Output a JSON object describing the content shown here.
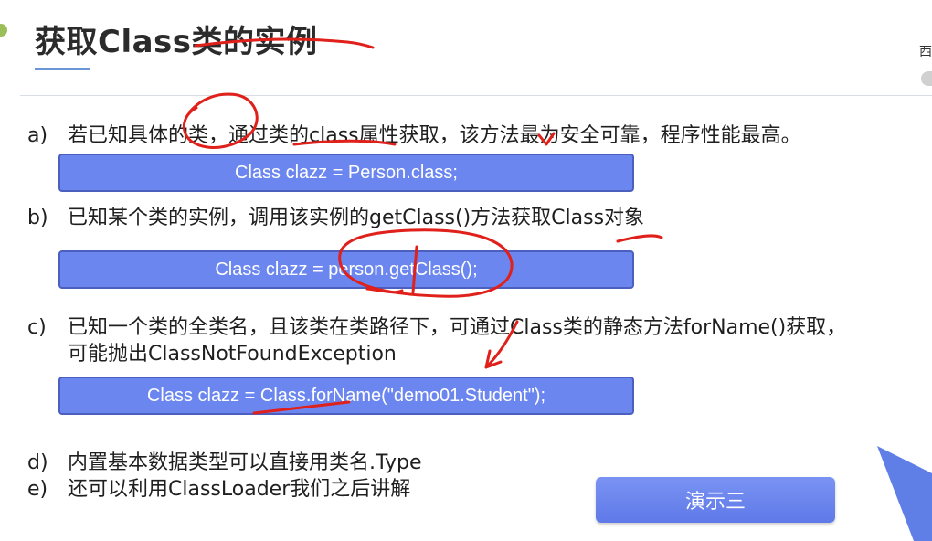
{
  "slide": {
    "title": "获取Class类的实例",
    "edge_text": "西",
    "items": [
      {
        "label": "a)",
        "text": "若已知具体的类，通过类的class属性获取，该方法最为安全可靠，程序性能最高。"
      },
      {
        "label": "b)",
        "text": "已知某个类的实例，调用该实例的getClass()方法获取Class对象"
      },
      {
        "label": "c)",
        "text": "已知一个类的全类名，且该类在类路径下，可通过Class类的静态方法forName()获取，",
        "text2": "可能抛出ClassNotFoundException"
      },
      {
        "label": "d)",
        "text": "内置基本数据类型可以直接用类名.Type"
      },
      {
        "label": "e)",
        "text": "还可以利用ClassLoader我们之后讲解"
      }
    ],
    "code": {
      "a": "Class clazz = Person.class;",
      "b": "Class clazz = person.getClass();",
      "c": "Class clazz = Class.forName(\"demo01.Student\");"
    },
    "demo_button": "演示三"
  },
  "colors": {
    "code_box": "#6c86f0",
    "annotation": "#e0201a",
    "title_accent": "#6a96d6"
  }
}
